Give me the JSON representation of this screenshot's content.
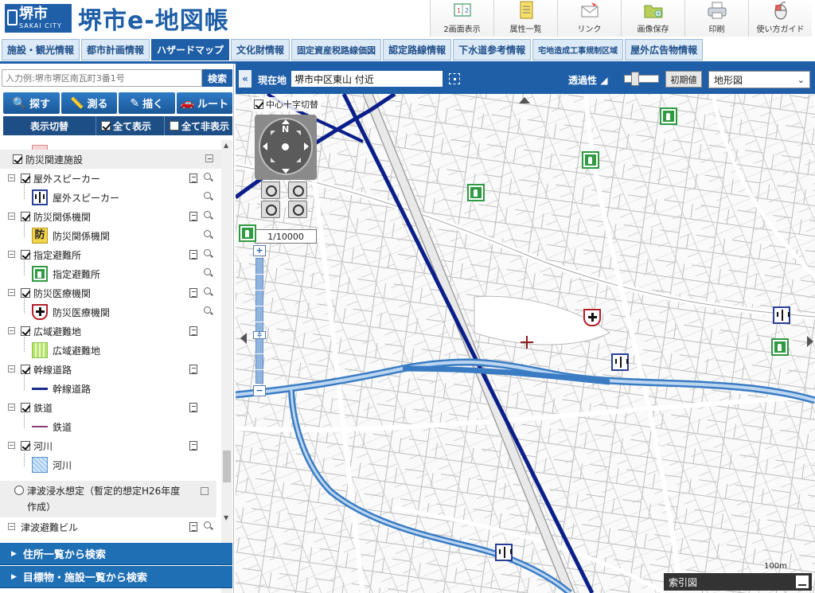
{
  "header": {
    "logo_main": "堺市",
    "logo_sub": "SAKAI CITY",
    "app_title": "堺市e-地図帳",
    "toolbar": [
      {
        "label": "2画面表示",
        "icon": "dual-screen-icon"
      },
      {
        "label": "属性一覧",
        "icon": "attribute-list-icon"
      },
      {
        "label": "リンク",
        "icon": "link-icon"
      },
      {
        "label": "画像保存",
        "icon": "image-save-icon"
      },
      {
        "label": "印刷",
        "icon": "print-icon"
      },
      {
        "label": "使い方ガイド",
        "icon": "guide-icon"
      }
    ]
  },
  "tabs": [
    {
      "label": "施設・観光情報",
      "active": false
    },
    {
      "label": "都市計画情報",
      "active": false
    },
    {
      "label": "ハザードマップ",
      "active": true
    },
    {
      "label": "文化財情報",
      "active": false
    },
    {
      "label": "固定資産税路線価図",
      "active": false
    },
    {
      "label": "認定路線情報",
      "active": false
    },
    {
      "label": "下水道参考情報",
      "active": false
    },
    {
      "label": "宅地造成工事規制区域",
      "active": false
    },
    {
      "label": "屋外広告物情報",
      "active": false
    }
  ],
  "left_panel": {
    "search_placeholder": "入力例:堺市堺区南瓦町3番1号",
    "search_button": "検索",
    "functions": [
      {
        "label": "探す",
        "icon": "search-icon"
      },
      {
        "label": "測る",
        "icon": "ruler-icon"
      },
      {
        "label": "描く",
        "icon": "pen-icon"
      },
      {
        "label": "ルート",
        "icon": "route-icon"
      }
    ],
    "display_toggle": "表示切替",
    "show_all": "全て表示",
    "hide_all": "全て非表示",
    "section_header": "防災関連施設",
    "layers": [
      {
        "name": "屋外スピーカー",
        "legend": "屋外スピーカー",
        "legend_type": "speaker",
        "checked": true,
        "has_search": true
      },
      {
        "name": "防災関係機関",
        "legend": "防災関係機関",
        "legend_type": "bousai",
        "checked": true,
        "has_search": true
      },
      {
        "name": "指定避難所",
        "legend": "指定避難所",
        "legend_type": "evac",
        "checked": true,
        "has_search": true
      },
      {
        "name": "防災医療機関",
        "legend": "防災医療機関",
        "legend_type": "medical",
        "checked": true,
        "has_search": true
      },
      {
        "name": "広域避難地",
        "legend": "広域避難地",
        "legend_type": "wide",
        "checked": true,
        "has_search": false
      },
      {
        "name": "幹線道路",
        "legend": "幹線道路",
        "legend_type": "road",
        "checked": true,
        "has_search": false
      },
      {
        "name": "鉄道",
        "legend": "鉄道",
        "legend_type": "rail",
        "checked": true,
        "has_search": false
      },
      {
        "name": "河川",
        "legend": "河川",
        "legend_type": "river",
        "checked": true,
        "has_search": false
      }
    ],
    "tsunami_line1": "津波浸水想定（暫定的想定H26年度",
    "tsunami_line2": "作成）",
    "tsunami_building": "津波避難ビル",
    "search_panels": [
      "住所一覧から検索",
      "目標物・施設一覧から検索"
    ]
  },
  "map_bar": {
    "location_label": "現在地",
    "location_value": "堺市中区東山 付近",
    "opacity_label": "透過性",
    "reset_button": "初期値",
    "map_type": "地形図"
  },
  "map": {
    "crosshair_label": "中心十字切替",
    "compass_n": "N",
    "scale": "1/10000",
    "index_map": "索引図",
    "scale_bar": "100m",
    "colors": {
      "road_major": "#0b1f8a",
      "river": "#3a7cc4",
      "evac_green": "#2e9a41",
      "brand_blue": "#1f5fa8"
    }
  }
}
